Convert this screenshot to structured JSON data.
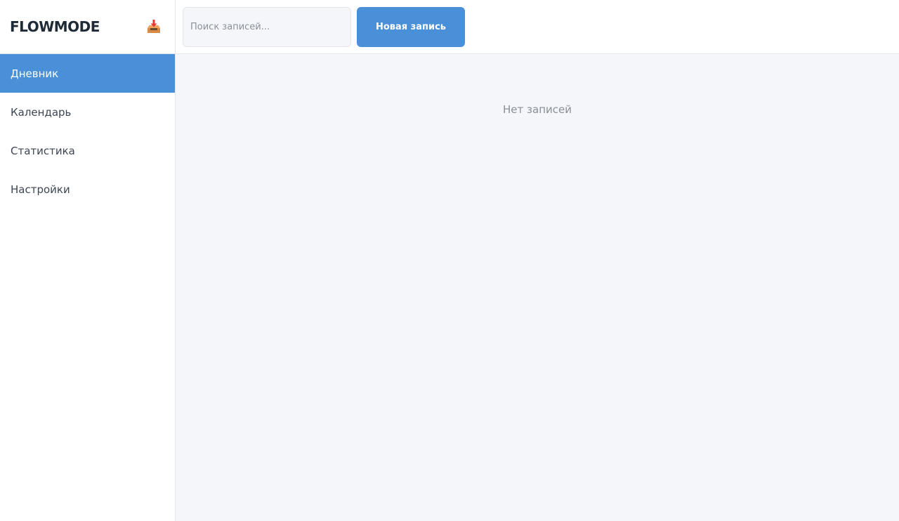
{
  "app": {
    "logo": "FLOWMODE"
  },
  "sidebar": {
    "items": [
      {
        "label": "Дневник",
        "active": true
      },
      {
        "label": "Календарь",
        "active": false
      },
      {
        "label": "Статистика",
        "active": false
      },
      {
        "label": "Настройки",
        "active": false
      }
    ],
    "import_icon": "inbox-tray-icon"
  },
  "header": {
    "search": {
      "placeholder": "Поиск записей...",
      "value": ""
    },
    "new_entry_label": "Новая запись"
  },
  "main": {
    "empty_text": "Нет записей"
  },
  "colors": {
    "accent": "#4a90d9",
    "main_bg": "#f4f6fa",
    "sidebar_bg": "#ffffff"
  }
}
